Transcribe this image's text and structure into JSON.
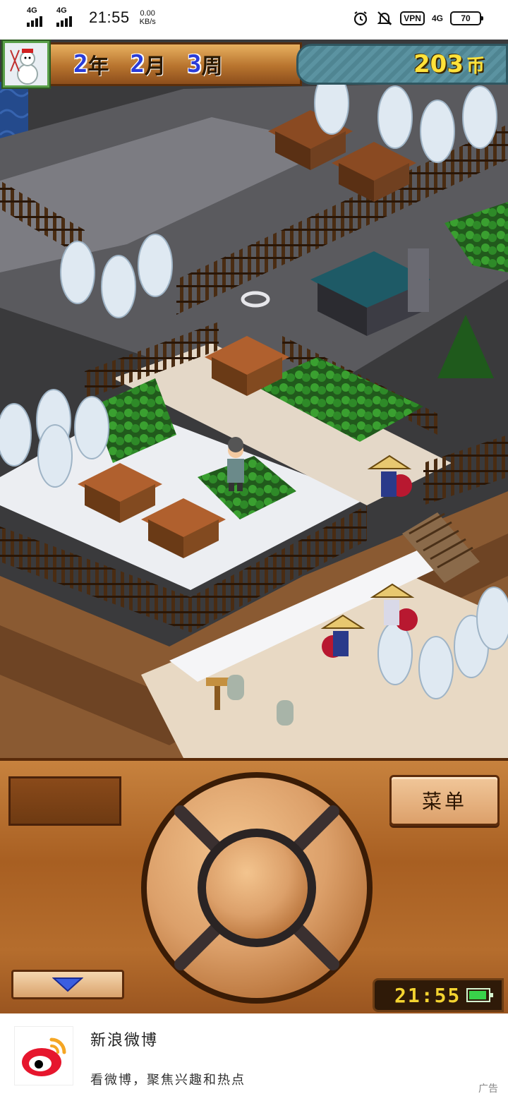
{
  "status_bar": {
    "net1": "4G",
    "net2": "4G",
    "time": "21:55",
    "speed_value": "0.00",
    "speed_unit": "KB/s",
    "vpn": "VPN",
    "net_right": "4G",
    "battery": "70",
    "icons": [
      "alarm-icon",
      "silent-bell-icon"
    ]
  },
  "hud": {
    "year": "2",
    "year_unit": "年",
    "month": "2",
    "month_unit": "月",
    "week": "3",
    "week_unit": "周",
    "money": "203",
    "currency": "币"
  },
  "controls": {
    "menu_label": "菜单",
    "clock_time": "21:55",
    "down_icon": "triangle-down-icon",
    "dpad": "circular-dpad"
  },
  "ad": {
    "title": "新浪微博",
    "description": "看微博，聚焦兴趣和热点",
    "tag": "广告",
    "logo": "weibo-logo"
  },
  "colors": {
    "wood": "#b56d2d",
    "money_text": "#ffe23a",
    "date_number": "#2a3cd8",
    "clock_text": "#f4d330"
  }
}
